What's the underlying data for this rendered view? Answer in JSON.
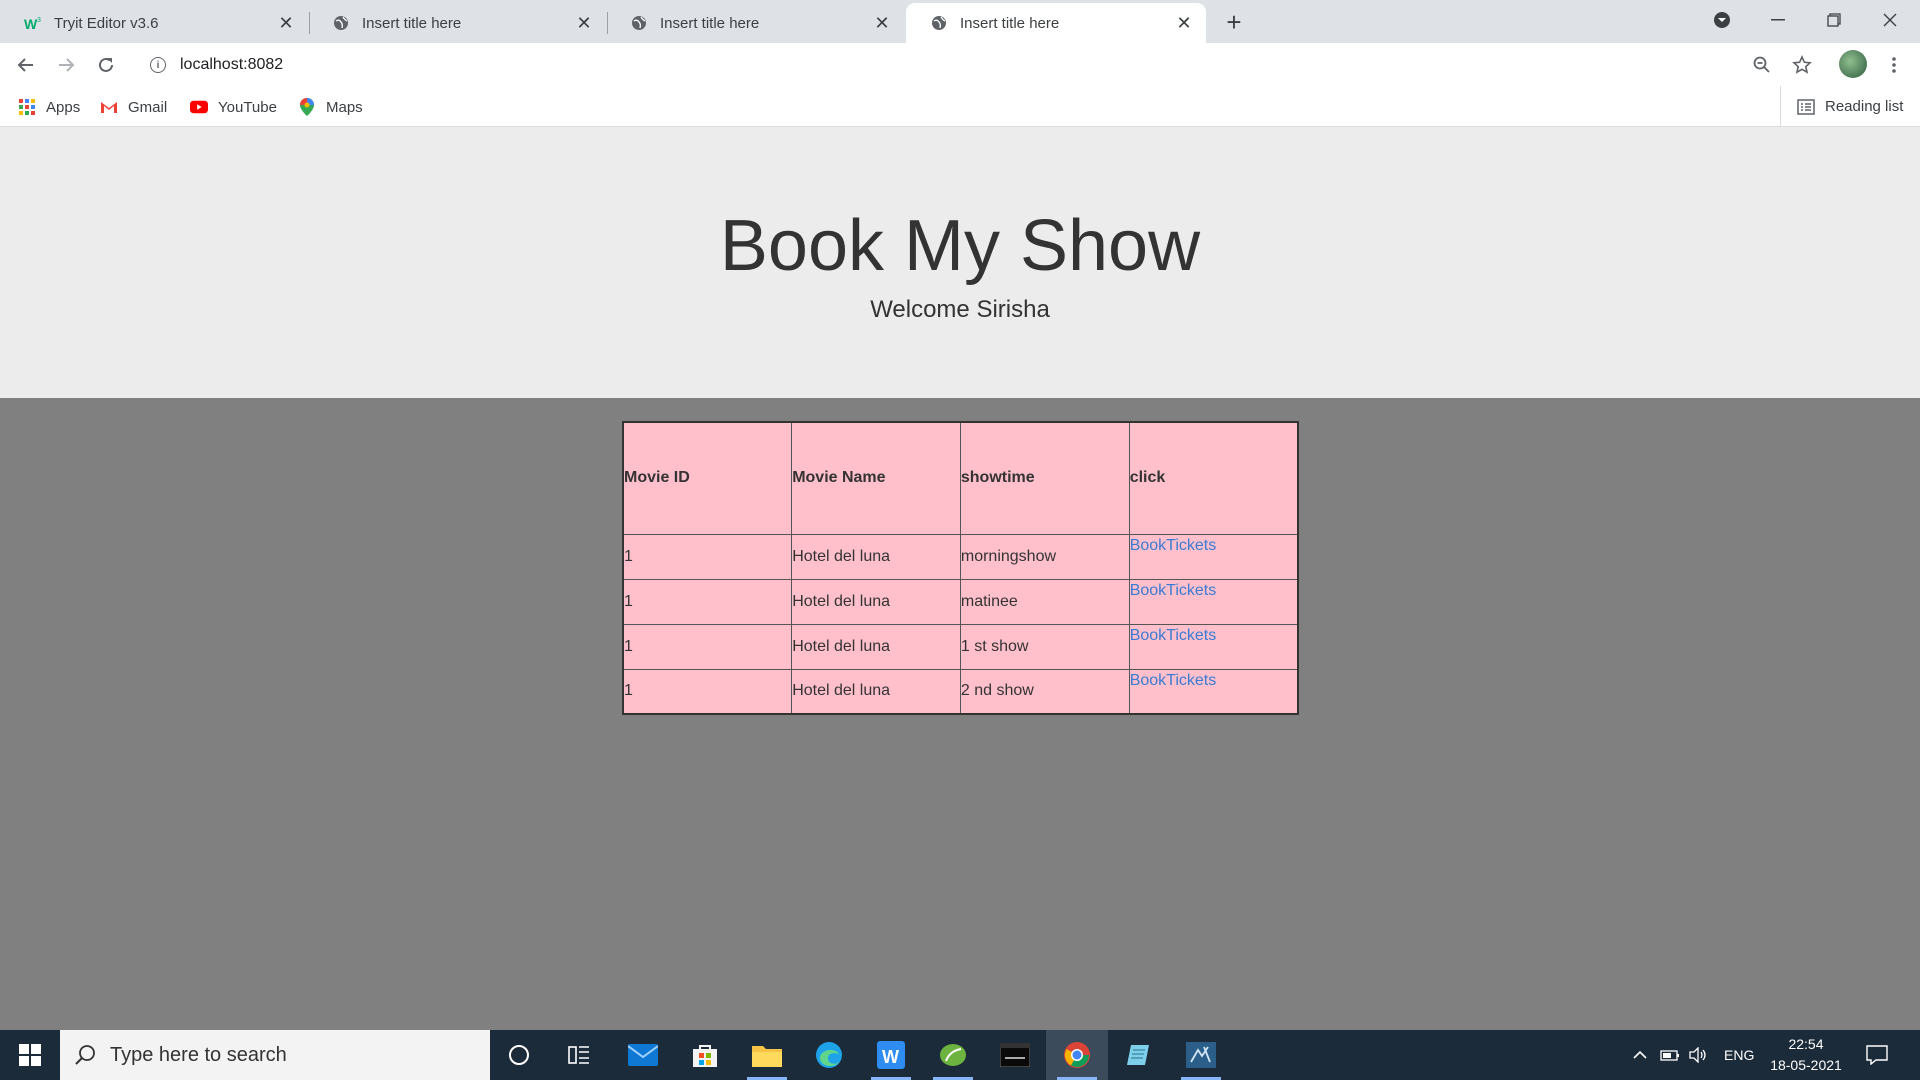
{
  "browser": {
    "tabs": [
      {
        "title": "Tryit Editor v3.6"
      },
      {
        "title": "Insert title here"
      },
      {
        "title": "Insert title here"
      },
      {
        "title": "Insert title here"
      }
    ],
    "url": "localhost:8082",
    "bookmarks": [
      "Apps",
      "Gmail",
      "YouTube",
      "Maps"
    ],
    "reading_list": "Reading list"
  },
  "page": {
    "title": "Book My Show",
    "welcome": "Welcome Sirisha",
    "table": {
      "headers": [
        "Movie ID",
        "Movie Name",
        "showtime",
        "click"
      ],
      "rows": [
        {
          "id": "1",
          "name": "Hotel del luna",
          "showtime": "morningshow",
          "link": "BookTickets"
        },
        {
          "id": "1",
          "name": "Hotel del luna",
          "showtime": "matinee",
          "link": "BookTickets"
        },
        {
          "id": "1",
          "name": "Hotel del luna",
          "showtime": "1 st show",
          "link": "BookTickets"
        },
        {
          "id": "1",
          "name": "Hotel del luna",
          "showtime": "2 nd show",
          "link": "BookTickets"
        }
      ],
      "background_color": "#ffc0cb",
      "link_color": "#3a7bd5"
    }
  },
  "taskbar": {
    "search_placeholder": "Type here to search",
    "language": "ENG",
    "time": "22:54",
    "date": "18-05-2021"
  }
}
